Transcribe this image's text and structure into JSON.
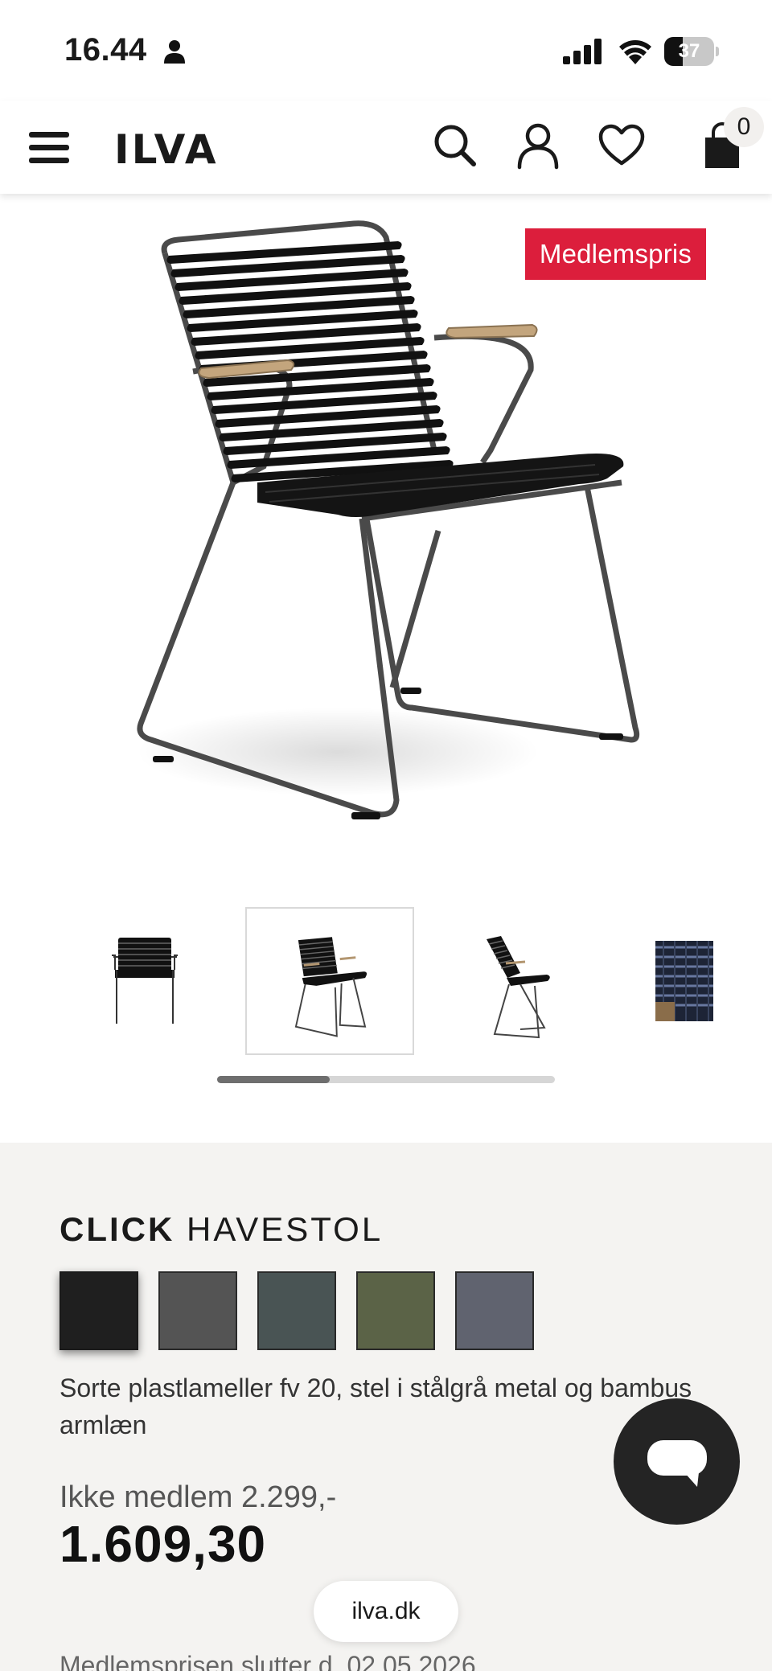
{
  "status_bar": {
    "time": "16.44",
    "battery": "37",
    "battery_level": 0.37
  },
  "header": {
    "logo": "ILVA",
    "cart_count": "0",
    "icons": [
      "menu-icon",
      "search-icon",
      "account-icon",
      "heart-icon",
      "cart-icon"
    ]
  },
  "product": {
    "badge": "Medlemspris",
    "title_bold": "CLICK",
    "title_rest": "HAVESTOL",
    "description": "Sorte plastlameller fv 20, stel i stålgrå metal og bambus armlæn",
    "not_member_price": "Ikke medlem 2.299,-",
    "price": "1.609,30",
    "member_price_end": "Medlemsprisen slutter d. 02.05.2026"
  },
  "gallery": {
    "selected_index": 1,
    "scroll_position": 0.33
  },
  "swatches": [
    {
      "color": "#1f1f1f",
      "selected": true
    },
    {
      "color": "#545454",
      "selected": false
    },
    {
      "color": "#495454",
      "selected": false
    },
    {
      "color": "#5b6347",
      "selected": false
    },
    {
      "color": "#60636f",
      "selected": false
    }
  ],
  "colors": {
    "badge": "#dc1e3c",
    "info_background": "#f4f3f1",
    "chat_button": "#242424"
  },
  "browser": {
    "url": "ilva.dk"
  }
}
